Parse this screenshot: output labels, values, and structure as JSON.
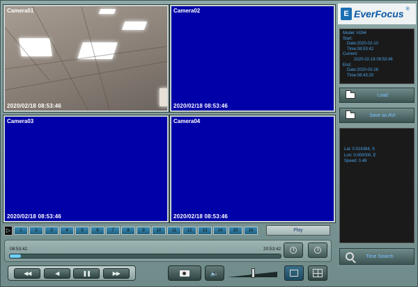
{
  "cameras": [
    {
      "label": "Camera01",
      "timestamp": "2020/02/18  08:53:46",
      "has_video": true
    },
    {
      "label": "Camera02",
      "timestamp": "2020/02/18  08:53:46",
      "has_video": false
    },
    {
      "label": "Camera03",
      "timestamp": "2020/02/18  08:53:46",
      "has_video": false
    },
    {
      "label": "Camera04",
      "timestamp": "2020/02/18  08:53:46",
      "has_video": false
    }
  ],
  "logo": {
    "mark": "E",
    "text": "EverFocus",
    "reg": "®",
    "color": "#0b57a3"
  },
  "info": {
    "model": "Model: H264",
    "start": "Start:",
    "start_date": "Date:2020-02-10",
    "start_time": "Time:08:53:42",
    "current": "Current:",
    "current_value": "2020-02-18 08:53:46",
    "end": "End:",
    "end_date": "Date:2020-03-26",
    "end_time": "Time:08:43:20"
  },
  "side_buttons": {
    "load": "Load",
    "save_avi": "Save as AVI",
    "time_search": "Time Search"
  },
  "gps": {
    "lat": "Lat: 0.016384, S",
    "lon": "Lon: 0.000000, E",
    "speed": "Speed: 0.48"
  },
  "channels": [
    "1",
    "2",
    "3",
    "4",
    "5",
    "6",
    "7",
    "8",
    "9",
    "10",
    "11",
    "12",
    "13",
    "14",
    "15",
    "16"
  ],
  "play_label": "Play",
  "timeline": {
    "start": "08:53:42",
    "end": "20:53:42",
    "progress_fraction": 0.04
  },
  "transport": {
    "rewind": "◀◀",
    "back": "◀",
    "pause": "❚❚",
    "forward": "▶▶"
  },
  "volume": {
    "icon": "🔈",
    "level_fraction": 0.52
  },
  "colors": {
    "video_blue": "#0000a8",
    "info_text": "#4aa3e8",
    "accent": "#6fd0ff"
  }
}
